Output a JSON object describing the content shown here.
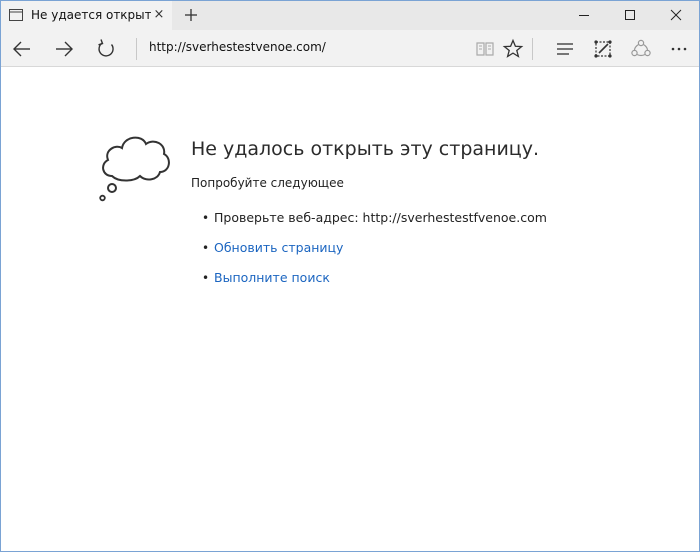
{
  "tab": {
    "title": "Не удается открыть эту",
    "close_glyph": "×"
  },
  "window_controls": {
    "minimize": "minimize-icon",
    "maximize": "maximize-icon",
    "close": "close-icon"
  },
  "nav": {
    "address": "http://sverhestestvenoe.com/",
    "icons": [
      "back-arrow-icon",
      "forward-arrow-icon",
      "refresh-icon",
      "reading-view-icon",
      "favorite-star-icon",
      "hub-icon",
      "web-note-icon",
      "share-icon",
      "more-icon"
    ]
  },
  "error": {
    "title": "Не удалось открыть эту страницу.",
    "subtitle": "Попробуйте следующее",
    "bullet": "•",
    "items": [
      {
        "text": "Проверьте веб-адрес: http://sverhestestfvenoe.com",
        "link": false
      },
      {
        "text": "Обновить страницу",
        "link": true
      },
      {
        "text": "Выполните поиск",
        "link": true
      }
    ]
  },
  "colors": {
    "link": "#1b65c0",
    "tab_bar": "#e8e8e8",
    "active_tab": "#f2f2f2",
    "window_border": "#7aa3d4"
  }
}
